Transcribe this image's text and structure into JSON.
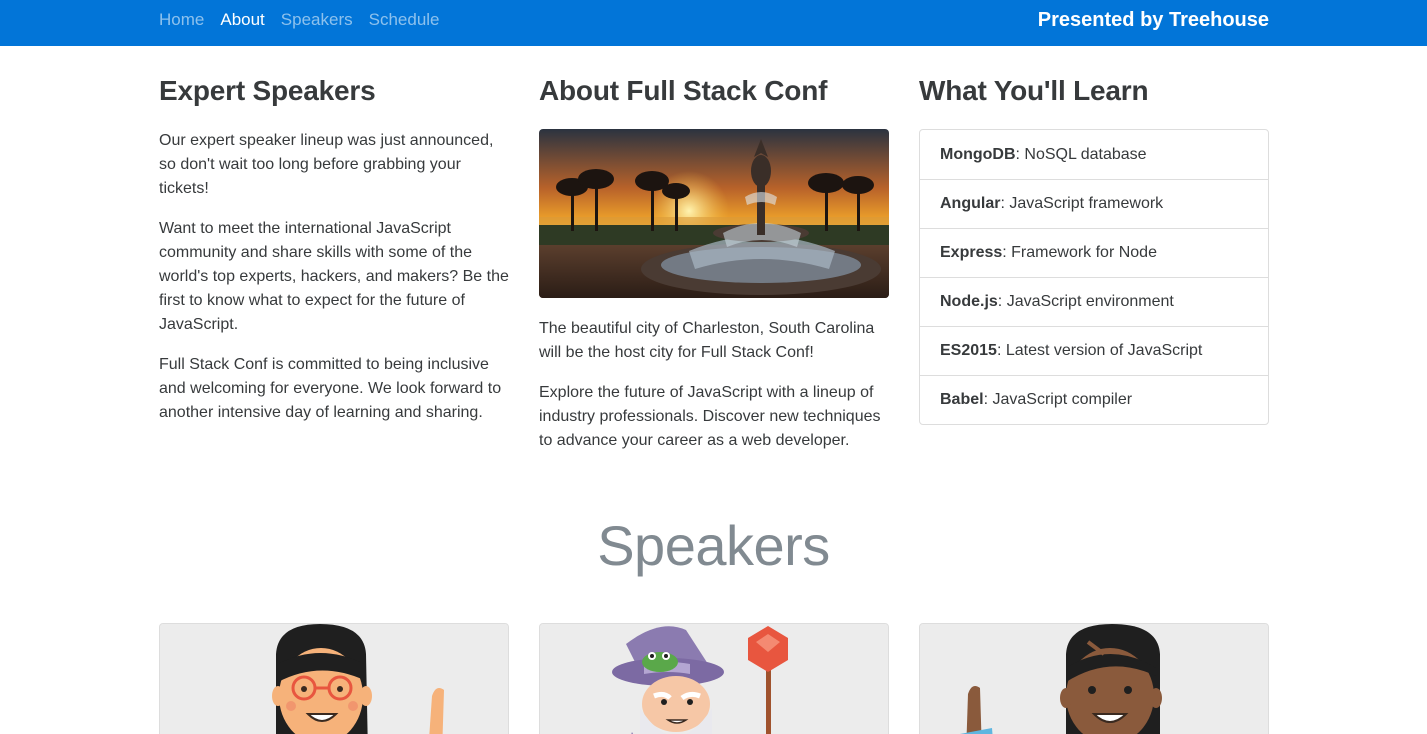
{
  "navbar": {
    "links": [
      "Home",
      "About",
      "Speakers",
      "Schedule"
    ],
    "brand": "Presented by Treehouse",
    "accent": "#0275d8"
  },
  "about": {
    "col1": {
      "heading": "Expert Speakers",
      "paragraphs": [
        "Our expert speaker lineup was just announced, so don't wait too long before grabbing your tickets!",
        "Want to meet the international JavaScript community and share skills with some of the world's top experts, hackers, and makers? Be the first to know what to expect for the future of JavaScript.",
        "Full Stack Conf is committed to being inclusive and welcoming for everyone. We look forward to another intensive day of learning and sharing."
      ]
    },
    "col2": {
      "heading": "About Full Stack Conf",
      "image": "charleston-pineapple-fountain-image",
      "paragraphs": [
        "The beautiful city of Charleston, South Carolina will be the host city for Full Stack Conf!",
        "Explore the future of JavaScript with a lineup of industry professionals. Discover new techniques to advance your career as a web developer."
      ]
    },
    "col3": {
      "heading": "What You'll Learn",
      "items": [
        {
          "name": "MongoDB",
          "desc": ": NoSQL database"
        },
        {
          "name": "Angular",
          "desc": ": JavaScript framework"
        },
        {
          "name": "Express",
          "desc": ": Framework for Node"
        },
        {
          "name": "Node.js",
          "desc": ": JavaScript environment"
        },
        {
          "name": "ES2015",
          "desc": ": Latest version of JavaScript"
        },
        {
          "name": "Babel",
          "desc": ": JavaScript compiler"
        }
      ]
    }
  },
  "speakers": {
    "title": "Speakers",
    "cards": [
      "woman-with-glasses-avatar",
      "wizard-with-frog-avatar",
      "man-waving-avatar"
    ]
  }
}
